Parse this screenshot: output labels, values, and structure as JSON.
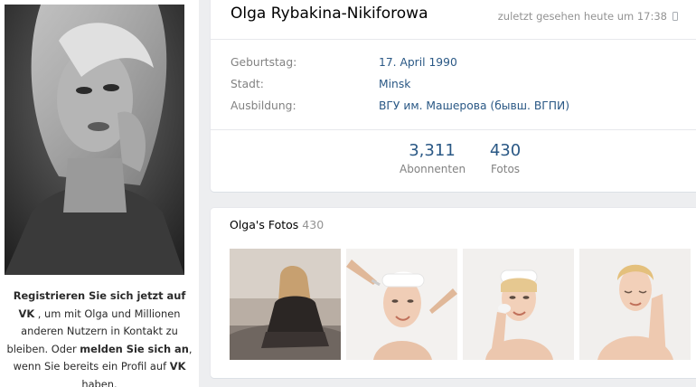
{
  "profile": {
    "name": "Olga Rybakina-Nikiforowa",
    "last_seen": "zuletzt gesehen heute um 17:38",
    "info": [
      {
        "label": "Geburtstag:",
        "value": "17. April 1990"
      },
      {
        "label": "Stadt:",
        "value": "Minsk"
      },
      {
        "label": "Ausbildung:",
        "value": "ВГУ им. Машерова (бывш. ВГПИ)"
      }
    ],
    "counters": [
      {
        "value": "3,311",
        "label": "Abonnenten"
      },
      {
        "value": "430",
        "label": "Fotos"
      }
    ]
  },
  "signup": {
    "bold1": "Registrieren Sie sich jetzt auf VK",
    "text1": " , um mit Olga und Millionen anderen Nutzern in Kontakt zu bleiben. Oder ",
    "bold2": "melden Sie sich an",
    "text2": ", wenn Sie bereits ein Profil auf ",
    "bold3": "VK",
    "text3": " haben."
  },
  "photos": {
    "title": "Olga's Fotos",
    "count": "430"
  },
  "icons": {
    "phone": "mobile-phone-icon"
  },
  "colors": {
    "link": "#2a5885",
    "label": "#828282",
    "background": "#edeef0"
  }
}
